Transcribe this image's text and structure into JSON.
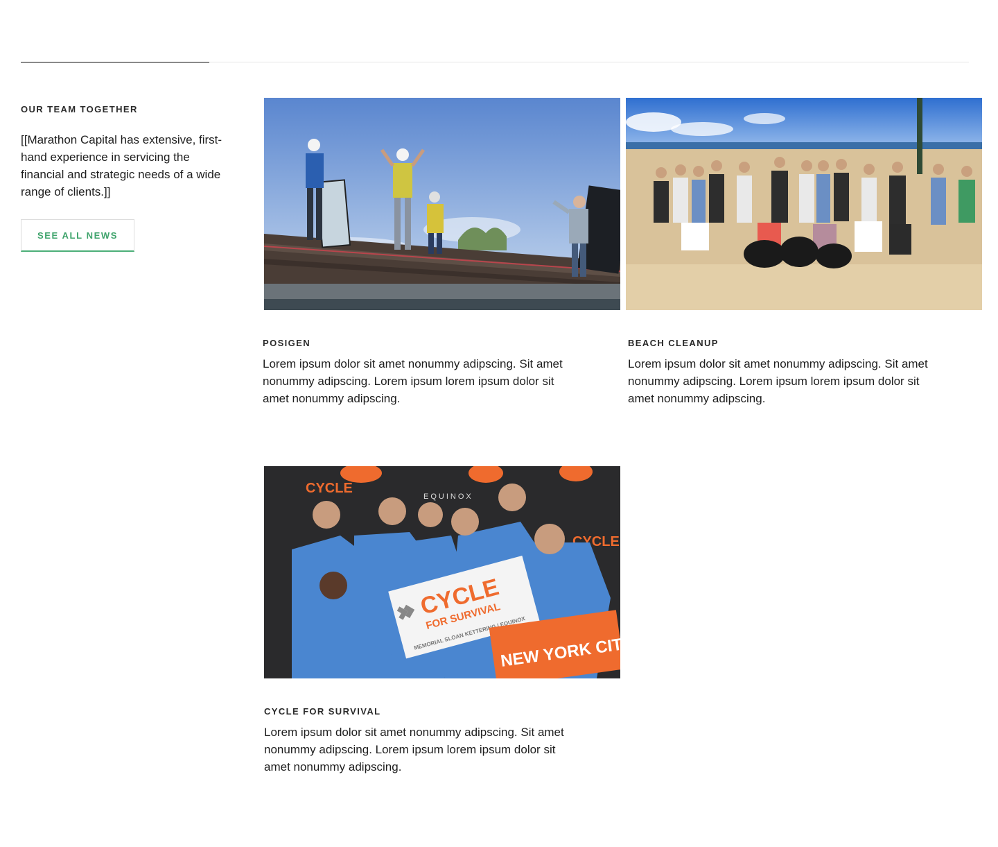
{
  "section": {
    "heading": "OUR TEAM TOGETHER",
    "intro": "[[Marathon Capital has extensive, first-hand experience in servicing the financial and strategic needs of a wide range of clients.]]",
    "see_all_label": "SEE ALL NEWS"
  },
  "cards": [
    {
      "title": "POSIGEN",
      "text": "Lorem ipsum dolor sit amet nonummy adipscing. Sit amet nonummy adipscing. Lorem ipsum lorem ipsum dolor sit amet nonummy adipscing."
    },
    {
      "title": "BEACH CLEANUP",
      "text": "Lorem ipsum dolor sit amet nonummy adipscing. Sit amet nonummy adipscing. Lorem ipsum lorem ipsum dolor sit amet nonummy adipscing."
    },
    {
      "title": "CYCLE FOR SURVIVAL",
      "text": "Lorem ipsum dolor sit amet nonummy adipscing. Sit amet nonummy adipscing. Lorem ipsum lorem ipsum dolor sit amet nonummy adipscing.",
      "photo_sign": {
        "cycle": "CYCLE",
        "for_survival": "FOR SURVIVAL",
        "sponsors": "MEMORIAL SLOAN KETTERING | EQUINOX",
        "city": "NEW YORK CITY",
        "backdrop_brand": "EQUINOX"
      }
    }
  ],
  "colors": {
    "accent_green": "#3ea36b",
    "orange": "#ef6b2e",
    "shirt_blue": "#4a86d0"
  }
}
